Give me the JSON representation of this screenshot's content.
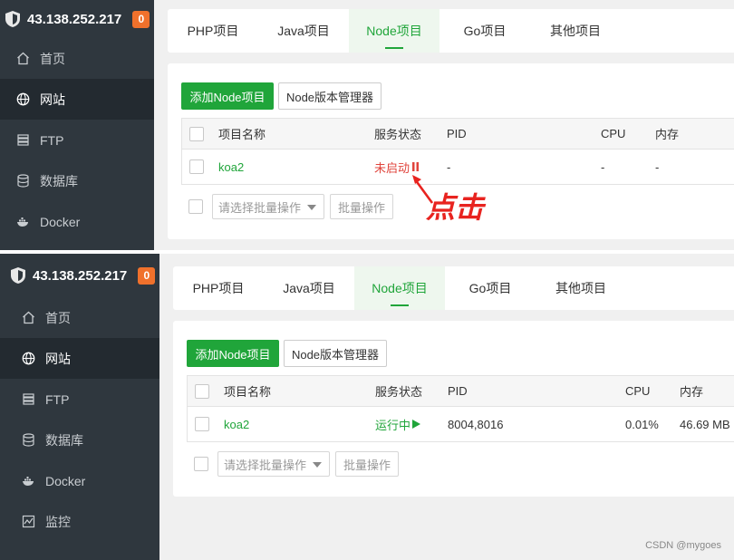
{
  "app": {
    "server_ip": "43.138.252.217",
    "notification_count": "0",
    "accent_color": "#20a53a"
  },
  "sidebar_top": [
    {
      "label": "首页",
      "icon": "home-icon"
    },
    {
      "label": "网站",
      "icon": "globe-icon"
    },
    {
      "label": "FTP",
      "icon": "ftp-icon"
    },
    {
      "label": "数据库",
      "icon": "database-icon"
    },
    {
      "label": "Docker",
      "icon": "docker-icon"
    }
  ],
  "sidebar_bottom": [
    {
      "label": "首页",
      "icon": "home-icon"
    },
    {
      "label": "网站",
      "icon": "globe-icon"
    },
    {
      "label": "FTP",
      "icon": "ftp-icon"
    },
    {
      "label": "数据库",
      "icon": "database-icon"
    },
    {
      "label": "Docker",
      "icon": "docker-icon"
    },
    {
      "label": "监控",
      "icon": "monitor-icon"
    }
  ],
  "tabs": [
    {
      "label": "PHP项目"
    },
    {
      "label": "Java项目"
    },
    {
      "label": "Node项目",
      "active": true
    },
    {
      "label": "Go项目"
    },
    {
      "label": "其他项目"
    }
  ],
  "toolbar": {
    "add_label": "添加Node项目",
    "version_manager_label": "Node版本管理器"
  },
  "table": {
    "headers": {
      "name": "项目名称",
      "status": "服务状态",
      "pid": "PID",
      "cpu": "CPU",
      "memory": "内存"
    }
  },
  "panel_before": {
    "row": {
      "name": "koa2",
      "status": "未启动",
      "pid": "-",
      "cpu": "-",
      "memory": "-"
    }
  },
  "panel_after": {
    "row": {
      "name": "koa2",
      "status": "运行中",
      "pid": "8004,8016",
      "cpu": "0.01%",
      "memory": "46.69 MB"
    }
  },
  "batch": {
    "placeholder": "请选择批量操作",
    "button_label": "批量操作"
  },
  "annotation": {
    "text": "点击",
    "color": "#e8231f"
  },
  "watermark": "CSDN @mygoes"
}
